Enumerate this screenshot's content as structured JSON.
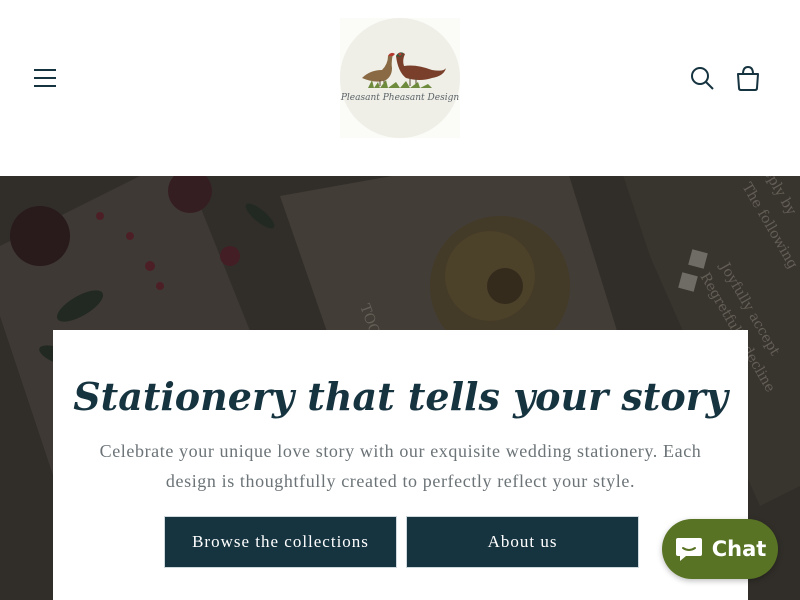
{
  "header": {
    "logo_text": "Pleasant Pheasant Design",
    "menu_icon": "hamburger-menu-icon",
    "search_icon": "search-icon",
    "cart_icon": "cart-icon"
  },
  "hero": {
    "heading": "Stationery that tells your story",
    "body": "Celebrate your unique love story with our exquisite wedding stationery. Each design is thoughtfully created to perfectly reflect your style.",
    "browse_label": "Browse the collections",
    "about_label": "About us",
    "background_text": [
      "TOG",
      "Joyfully accept",
      "Regretfully decline",
      "reply by",
      "The following"
    ]
  },
  "chat": {
    "label": "Chat",
    "icon": "chat-bubble-icon"
  },
  "colors": {
    "primary": "#163340",
    "chat_green": "#587324",
    "body_text": "#6b7377"
  }
}
